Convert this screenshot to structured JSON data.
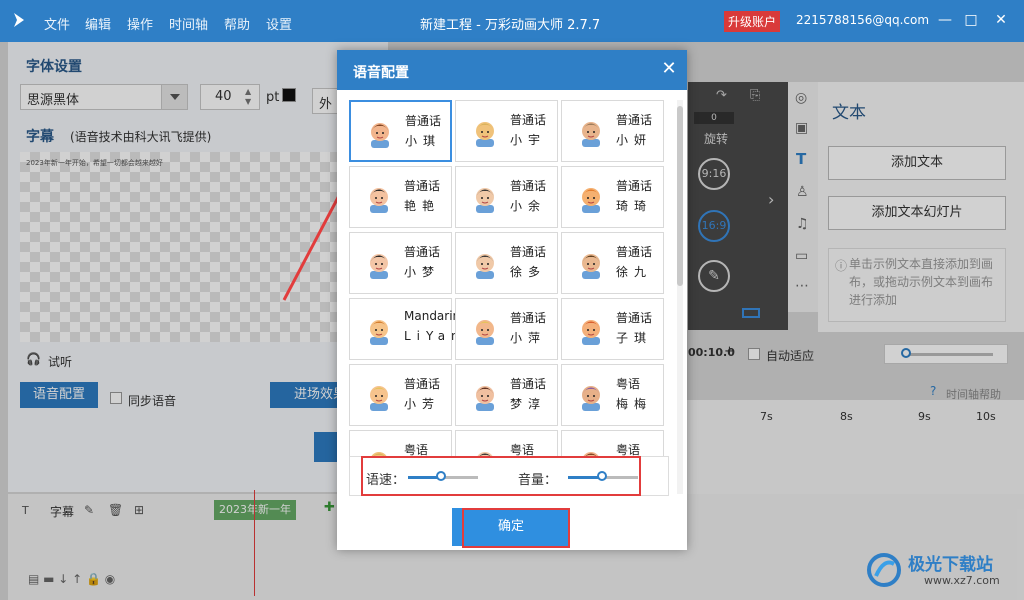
{
  "app": {
    "title": "新建工程 - 万彩动画大师 2.7.7",
    "menu": [
      "文件",
      "编辑",
      "操作",
      "时间轴",
      "帮助",
      "设置"
    ],
    "upgrade": "升级账户",
    "email": "2215788156@qq.com"
  },
  "left_panel": {
    "font_settings": "字体设置",
    "font_name": "思源黑体",
    "font_size": "40",
    "font_unit": "pt",
    "outer_tab": "外",
    "subtitle_label": "字幕",
    "subtitle_note": "(语音技术由科大讯飞提供)",
    "preview_text": "2023年新一年开始，希望一切都会越来越好",
    "listen": "试听",
    "voice_config_btn": "语音配置",
    "sync_voice": "同步语音",
    "enter_effect": "进场效果"
  },
  "right_panel": {
    "panel_title": "文本",
    "add_text": "添加文本",
    "add_text_slides": "添加文本幻灯片",
    "hint": "单击示例文本直接添加到画布，或拖动示例文本到画布进行添加",
    "rotate": "旋转",
    "rotate_value": "0",
    "time_label": "9:16",
    "ratio_label": "16:9",
    "auto_fit": "自动适应",
    "timeline_help": "时间轴帮助",
    "time_display": "00:10.0",
    "ruler": [
      "7s",
      "8s",
      "9s",
      "10s"
    ]
  },
  "timeline": {
    "track_name": "字幕",
    "clip_label": "2023年新一年"
  },
  "dialog": {
    "title": "语音配置",
    "voices": [
      {
        "l1": "普通话",
        "l2": "小琪",
        "face": "girl"
      },
      {
        "l1": "普通话",
        "l2": "小宇",
        "face": "boy"
      },
      {
        "l1": "普通话",
        "l2": "小妍",
        "face": "oldman"
      },
      {
        "l1": "普通话",
        "l2": "艳艳",
        "face": "girl2"
      },
      {
        "l1": "普通话",
        "l2": "小余",
        "face": "man"
      },
      {
        "l1": "普通话",
        "l2": "琦琦",
        "face": "girl3"
      },
      {
        "l1": "普通话",
        "l2": "小梦",
        "face": "girl4"
      },
      {
        "l1": "普通话",
        "l2": "徐多",
        "face": "man2"
      },
      {
        "l1": "普通话",
        "l2": "徐九",
        "face": "man3"
      },
      {
        "l1": "Mandarin",
        "l2": "LiYang",
        "face": "nerd"
      },
      {
        "l1": "普通话",
        "l2": "小萍",
        "face": "girl5"
      },
      {
        "l1": "普通话",
        "l2": "子琪",
        "face": "boy2"
      },
      {
        "l1": "普通话",
        "l2": "小芳",
        "face": "girl6"
      },
      {
        "l1": "普通话",
        "l2": "梦淳",
        "face": "girl7"
      },
      {
        "l1": "粤语",
        "l2": "梅梅",
        "face": "girl8"
      },
      {
        "l1": "粤语",
        "l2": "",
        "face": "boy"
      },
      {
        "l1": "粤语",
        "l2": "",
        "face": "man"
      },
      {
        "l1": "粤语",
        "l2": "",
        "face": "girl"
      }
    ],
    "speed_label": "语速：",
    "volume_label": "音量：",
    "confirm": "确定",
    "speed_value": 0.48,
    "volume_value": 0.5
  },
  "watermark": {
    "brand": "极光下载站",
    "url": "www.xz7.com"
  },
  "colors": {
    "accent": "#2f7fc6",
    "highlight": "#e23c3c"
  }
}
